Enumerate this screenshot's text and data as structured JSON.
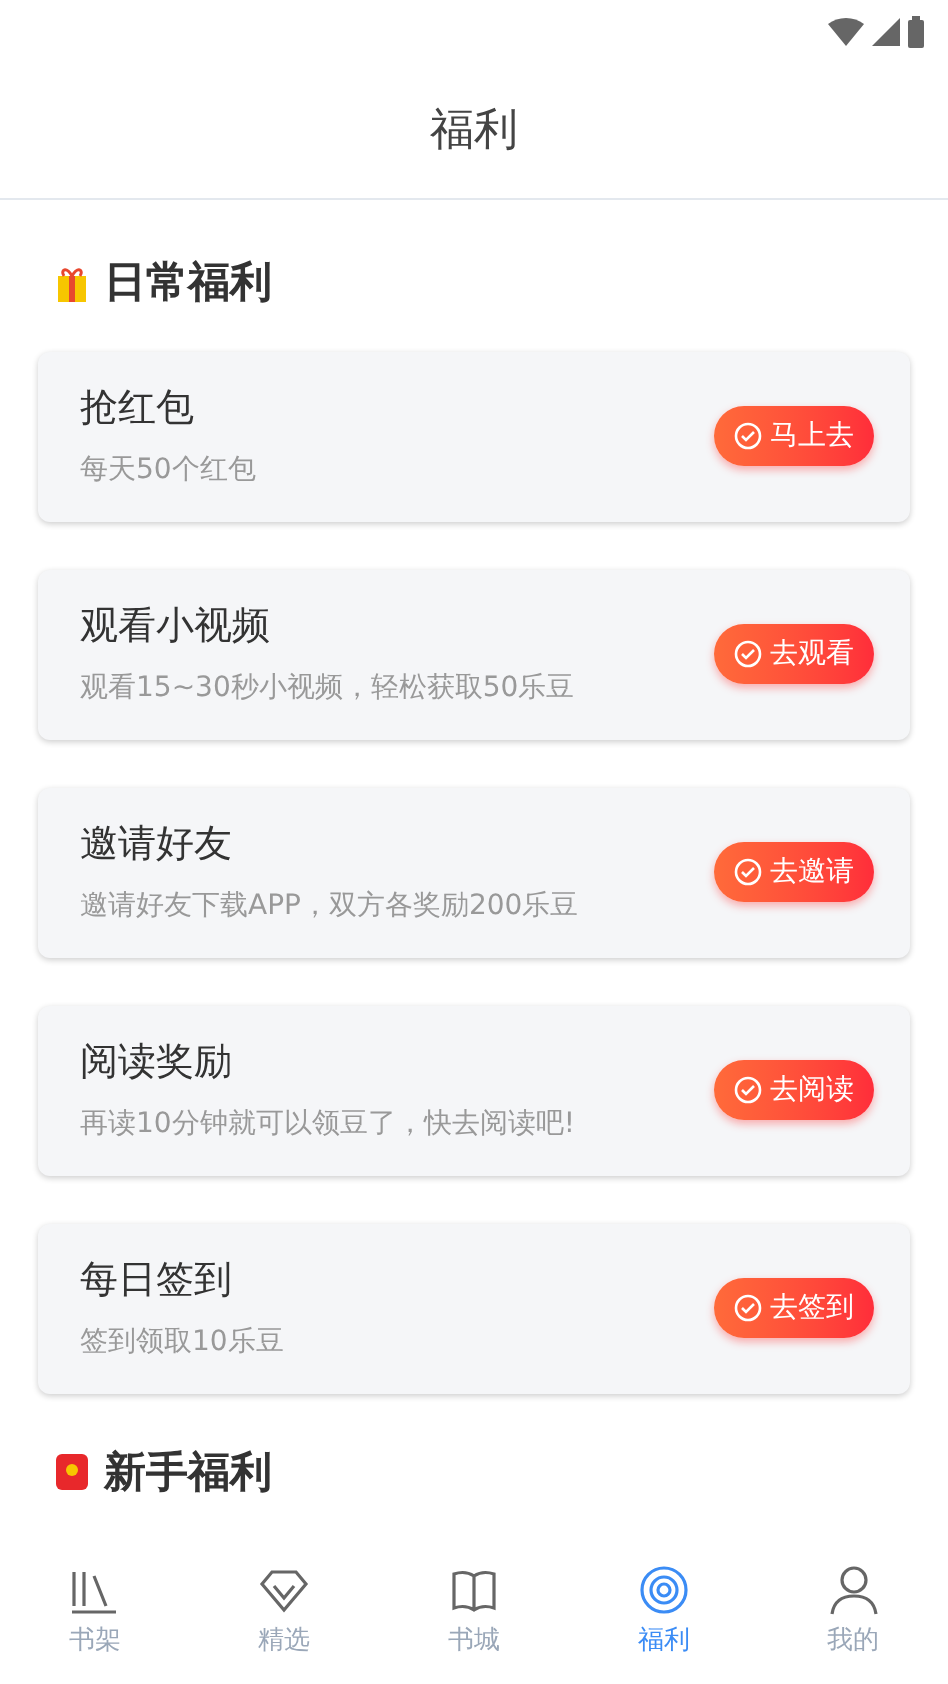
{
  "header": {
    "title": "福利"
  },
  "daily": {
    "title": "日常福利",
    "tasks": [
      {
        "title": "抢红包",
        "desc": "每天50个红包",
        "action": "马上去"
      },
      {
        "title": "观看小视频",
        "desc": "观看15~30秒小视频，轻松获取50乐豆",
        "action": "去观看"
      },
      {
        "title": "邀请好友",
        "desc": "邀请好友下载APP，双方各奖励200乐豆",
        "action": "去邀请"
      },
      {
        "title": "阅读奖励",
        "desc": "再读10分钟就可以领豆了，快去阅读吧!",
        "action": "去阅读"
      },
      {
        "title": "每日签到",
        "desc": "签到领取10乐豆",
        "action": "去签到"
      }
    ]
  },
  "newbie": {
    "title": "新手福利"
  },
  "tabs": [
    {
      "kind": "shelf",
      "label": "书架",
      "selected": false
    },
    {
      "kind": "featured",
      "label": "精选",
      "selected": false
    },
    {
      "kind": "store",
      "label": "书城",
      "selected": false
    },
    {
      "kind": "welfare",
      "label": "福利",
      "selected": true
    },
    {
      "kind": "profile",
      "label": "我的",
      "selected": false
    }
  ]
}
